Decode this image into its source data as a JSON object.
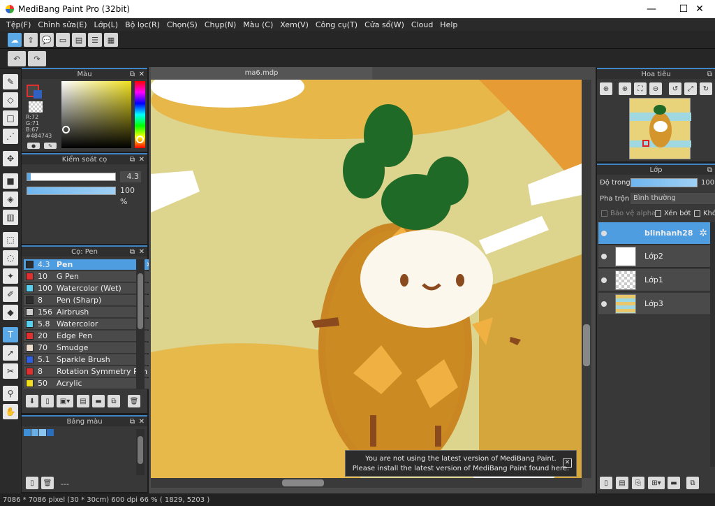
{
  "window": {
    "title": "MediBang Paint Pro (32bit)",
    "minimize": "—",
    "maximize": "☐",
    "close": "✕"
  },
  "menu": [
    "Tệp(F)",
    "Chỉnh sửa(E)",
    "Lớp(L)",
    "Bộ lọc(R)",
    "Chọn(S)",
    "Chụp(N)",
    "Màu (C)",
    "Xem(V)",
    "Công cụ(T)",
    "Cửa sổ(W)",
    "Cloud",
    "Help"
  ],
  "color_panel": {
    "title": "Màu",
    "r": "R:72",
    "g": "G:71",
    "b": "B:67",
    "hex": "#484743",
    "main_color": "#484743"
  },
  "brush_control": {
    "title": "Kiểm soát cọ",
    "size": "4.3",
    "opacity": "100 %"
  },
  "brush_panel": {
    "title": "Cọ: Pen",
    "items": [
      {
        "size": "4.3",
        "name": "Pen",
        "color": "#2c2c2c"
      },
      {
        "size": "10",
        "name": "G Pen",
        "color": "#e03030"
      },
      {
        "size": "100",
        "name": "Watercolor (Wet)",
        "color": "#5ad0f0"
      },
      {
        "size": "8",
        "name": "Pen (Sharp)",
        "color": "#2c2c2c"
      },
      {
        "size": "156",
        "name": "Airbrush",
        "color": "#cccccc"
      },
      {
        "size": "5.8",
        "name": "Watercolor",
        "color": "#5ad0f0"
      },
      {
        "size": "20",
        "name": "Edge Pen",
        "color": "#e03030"
      },
      {
        "size": "70",
        "name": "Smudge",
        "color": "#f0e0d0"
      },
      {
        "size": "5.1",
        "name": "Sparkle Brush",
        "color": "#3060e0"
      },
      {
        "size": "8",
        "name": "Rotation Symmetry Pen",
        "color": "#e03030"
      },
      {
        "size": "50",
        "name": "Acrylic",
        "color": "#f0e020"
      }
    ]
  },
  "palette_panel": {
    "title": "Bảng màu",
    "footer": "---",
    "swatches": [
      "#3f8fd6",
      "#6aaee6",
      "#8cc4f0",
      "#2a6fbf"
    ]
  },
  "document": {
    "tab": "ma6.mdp"
  },
  "notice": {
    "line1": "You are not using the latest version of MediBang Paint.",
    "line2": "Please install the latest version of MediBang Paint found here."
  },
  "navigator": {
    "title": "Hoa tiêu"
  },
  "layers_panel": {
    "title": "Lớp",
    "opacity_label": "Độ trong",
    "opacity_value": "100",
    "blend_label": "Pha trộn",
    "blend_value": "Bình thường",
    "protect_alpha": "Bảo vệ alpha",
    "clipping": "Xén bớt",
    "lock": "Khóa",
    "layers": [
      "blinhanh28",
      "Lớp2",
      "Lớp1",
      "Lớp3"
    ]
  },
  "status": {
    "text": "7086 * 7086 pixel   (30 * 30cm)   600 dpi   66 %   ( 1829, 5203 )"
  }
}
